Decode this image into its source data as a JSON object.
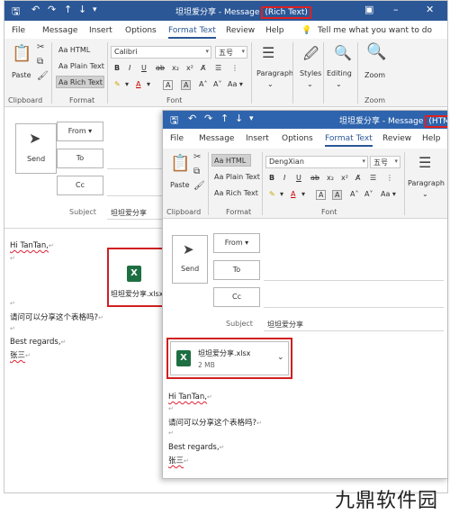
{
  "colors": {
    "titlebar": "#2b5797",
    "accent": "#2b5797",
    "highlight_box": "#d02020",
    "excel_green": "#1d6f42"
  },
  "back_window": {
    "title_prefix": "坦坦爱分享 - Message",
    "title_mode": "(Rich Text)",
    "menu": [
      "File",
      "Message",
      "Insert",
      "Options",
      "Format Text",
      "Review",
      "Help"
    ],
    "active_menu": "Format Text",
    "tell_me": "Tell me what you want to do",
    "ribbon": {
      "paste": "Paste",
      "clipboard": "Clipboard",
      "html": "Aa HTML",
      "plain_text": "Aa Plain Text",
      "rich_text": "Aa Rich Text",
      "format_group": "Format",
      "font_name": "Calibri",
      "font_size": "五号",
      "font_group": "Font",
      "paragraph": "Paragraph",
      "styles": "Styles",
      "editing": "Editing",
      "zoom": "Zoom",
      "zoom_group": "Zoom"
    },
    "from_label": "From",
    "to_label": "To",
    "cc_label": "Cc",
    "send_label": "Send",
    "subject_label": "Subject",
    "subject_value": "坦坦爱分享",
    "attachment_name": "坦坦爱分享.xlsx",
    "body": {
      "greeting": "Hi TanTan,",
      "question": "请问可以分享这个表格吗?",
      "regards": "Best regards,",
      "signature": "张三"
    }
  },
  "front_window": {
    "title_prefix": "坦坦爱分享 - Message",
    "title_mode": "(HTML)",
    "menu": [
      "File",
      "Message",
      "Insert",
      "Options",
      "Format Text",
      "Review",
      "Help"
    ],
    "active_menu": "Format Text",
    "ribbon": {
      "paste": "Paste",
      "clipboard": "Clipboard",
      "html": "Aa HTML",
      "plain_text": "Aa Plain Text",
      "rich_text": "Aa Rich Text",
      "format_group": "Format",
      "font_name": "DengXian",
      "font_size": "五号",
      "font_group": "Font",
      "paragraph": "Paragraph"
    },
    "from_label": "From",
    "to_label": "To",
    "cc_label": "Cc",
    "send_label": "Send",
    "subject_label": "Subject",
    "subject_value": "坦坦爱分享",
    "attachment": {
      "name": "坦坦爱分享.xlsx",
      "size": "2 MB"
    },
    "body": {
      "greeting": "Hi TanTan,",
      "question": "请问可以分享这个表格吗?",
      "regards": "Best regards,",
      "signature": "张三"
    }
  },
  "watermark": "九鼎软件园"
}
